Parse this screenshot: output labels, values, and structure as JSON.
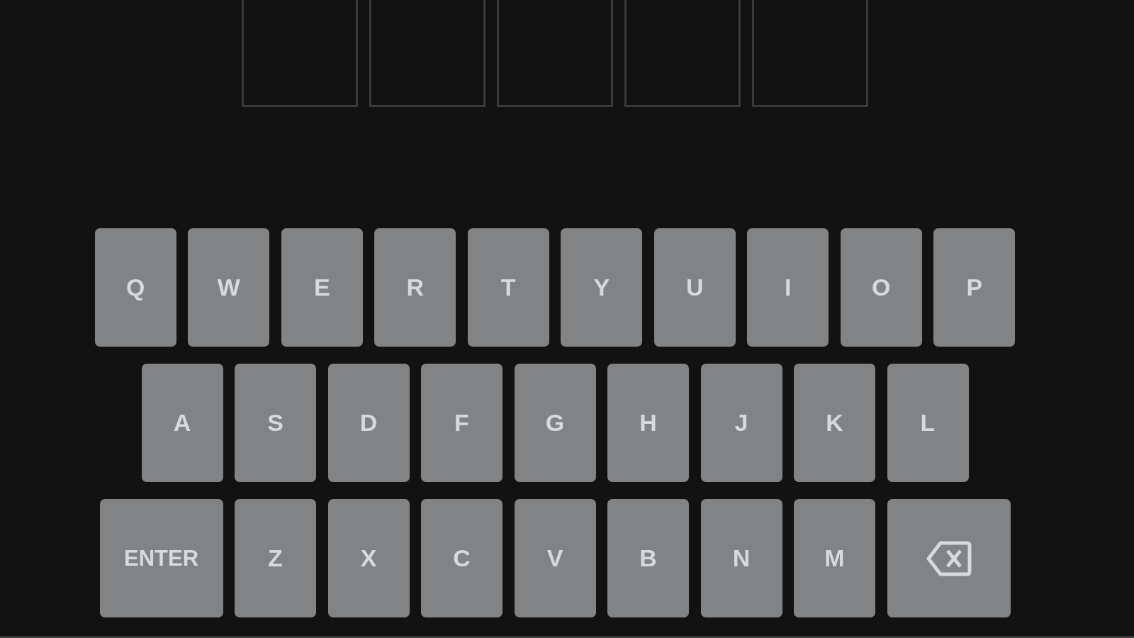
{
  "board": {
    "tiles": [
      {
        "filled": false
      },
      {
        "filled": false
      },
      {
        "filled": false
      },
      {
        "filled": false
      },
      {
        "filled": false
      }
    ]
  },
  "keyboard": {
    "rows": [
      {
        "keys": [
          {
            "kind": "letter",
            "label": "Q"
          },
          {
            "kind": "letter",
            "label": "W"
          },
          {
            "kind": "letter",
            "label": "E"
          },
          {
            "kind": "letter",
            "label": "R"
          },
          {
            "kind": "letter",
            "label": "T"
          },
          {
            "kind": "letter",
            "label": "Y"
          },
          {
            "kind": "letter",
            "label": "U"
          },
          {
            "kind": "letter",
            "label": "I"
          },
          {
            "kind": "letter",
            "label": "O"
          },
          {
            "kind": "letter",
            "label": "P"
          }
        ]
      },
      {
        "keys": [
          {
            "kind": "letter",
            "label": "A"
          },
          {
            "kind": "letter",
            "label": "S"
          },
          {
            "kind": "letter",
            "label": "D"
          },
          {
            "kind": "letter",
            "label": "F"
          },
          {
            "kind": "letter",
            "label": "G"
          },
          {
            "kind": "letter",
            "label": "H"
          },
          {
            "kind": "letter",
            "label": "J"
          },
          {
            "kind": "letter",
            "label": "K"
          },
          {
            "kind": "letter",
            "label": "L"
          }
        ]
      },
      {
        "keys": [
          {
            "kind": "enter",
            "label": "ENTER"
          },
          {
            "kind": "letter",
            "label": "Z"
          },
          {
            "kind": "letter",
            "label": "X"
          },
          {
            "kind": "letter",
            "label": "C"
          },
          {
            "kind": "letter",
            "label": "V"
          },
          {
            "kind": "letter",
            "label": "B"
          },
          {
            "kind": "letter",
            "label": "N"
          },
          {
            "kind": "letter",
            "label": "M"
          },
          {
            "kind": "backspace"
          }
        ]
      }
    ]
  }
}
